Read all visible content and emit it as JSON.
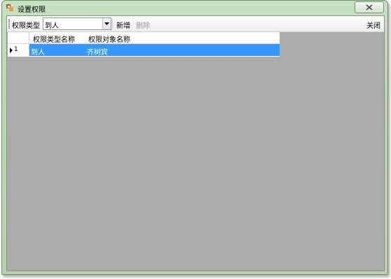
{
  "window": {
    "title": "设置权限",
    "close_label": "关闭"
  },
  "toolbar": {
    "type_label": "权限类型",
    "type_value": "到人",
    "add_label": "新增",
    "delete_label": "删除",
    "close_label": "关闭"
  },
  "grid": {
    "columns": [
      "权限类型名称",
      "权限对象名称"
    ],
    "rows": [
      {
        "num": "1",
        "type_name": "到人",
        "object_name": "齐树宾"
      }
    ]
  },
  "colors": {
    "selection": "#3399ff",
    "client_background": "#ababab",
    "frame": "#b7d6b1"
  }
}
